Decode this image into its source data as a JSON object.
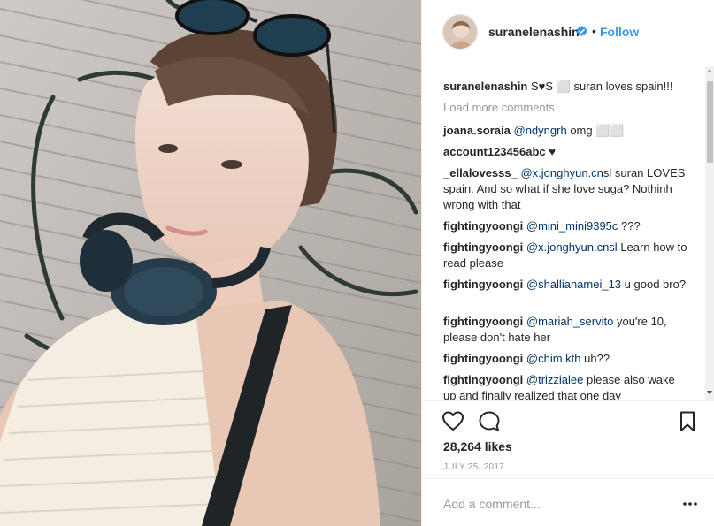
{
  "post": {
    "username": "suranelenashin",
    "follow_label": "Follow",
    "dot": "•"
  },
  "caption": {
    "user": "suranelenashin",
    "text": "S♥S ⬜ suran loves spain!!!"
  },
  "load_more": "Load more comments",
  "comments": [
    {
      "user": "joana.soraia",
      "mention": "@ndyngrh",
      "text": "omg ⬜⬜"
    },
    {
      "user": "account123456abc",
      "mention": "",
      "text": "♥"
    },
    {
      "user": "_ellalovesss_",
      "mention": "@x.jonghyun.cnsl",
      "text": "suran LOVES spain. And so what if she love suga? Nothinh wrong with that"
    },
    {
      "user": "fightingyoongi",
      "mention": "@mini_mini9395c",
      "text": "???"
    },
    {
      "user": "fightingyoongi",
      "mention": "@x.jonghyun.cnsl",
      "text": "Learn how to read please"
    },
    {
      "user": "fightingyoongi",
      "mention": "@shallianamei_13",
      "text": "u good bro?"
    },
    {
      "user": "fightingyoongi",
      "mention": "@mariah_servito",
      "text": "you're 10, please don't hate her"
    },
    {
      "user": "fightingyoongi",
      "mention": "@chim.kth",
      "text": "uh??"
    },
    {
      "user": "fightingyoongi",
      "mention": "@trizzialee",
      "text": "please also wake up and finally realized that one day"
    }
  ],
  "likes": "28,264 likes",
  "date": "JULY 25, 2017",
  "add_comment_placeholder": "Add a comment...",
  "icons": {
    "like": "heart-icon",
    "comment": "comment-icon",
    "save": "bookmark-icon",
    "more": "more-dots-icon",
    "verified": "verified-badge-icon"
  },
  "colors": {
    "follow": "#3897f0",
    "verified": "#3897f0",
    "muted": "#999999",
    "text": "#262626"
  }
}
